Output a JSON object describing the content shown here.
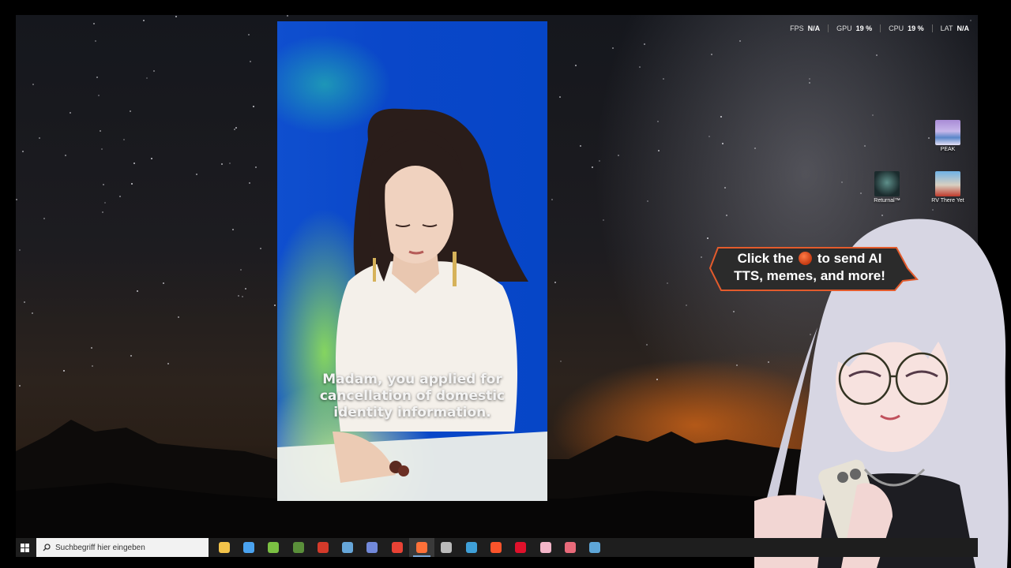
{
  "perf_overlay": [
    {
      "label": "FPS",
      "value": "N/A"
    },
    {
      "label": "GPU",
      "value": "19 %"
    },
    {
      "label": "CPU",
      "value": "19 %"
    },
    {
      "label": "LAT",
      "value": "N/A"
    }
  ],
  "desktop_icons": [
    {
      "label": "PEAK",
      "icon": "peak-game-icon"
    },
    {
      "label": "Returnal™",
      "icon": "returnal-game-icon"
    },
    {
      "label": "RV There Yet",
      "icon": "rv-there-yet-game-icon"
    }
  ],
  "video": {
    "subtitle_lines": [
      "Madam, you applied for",
      "cancellation of domestic",
      "identity information."
    ]
  },
  "callout": {
    "text_before": "Click the",
    "text_after": "to send AI",
    "line2": "TTS, memes, and more!",
    "icon": "bits-gem-icon"
  },
  "taskbar": {
    "search_placeholder": "Suchbegriff hier eingeben",
    "apps": [
      {
        "name": "file-explorer",
        "color": "#f3c34a"
      },
      {
        "name": "microsoft-store",
        "color": "#4aa3f0"
      },
      {
        "name": "android-app",
        "color": "#7bc043"
      },
      {
        "name": "minecraft",
        "color": "#5a8f3a"
      },
      {
        "name": "shop-app",
        "color": "#d43a2a"
      },
      {
        "name": "steam",
        "color": "#66a6d9"
      },
      {
        "name": "discord",
        "color": "#7289da"
      },
      {
        "name": "chrome",
        "color": "#e94235"
      },
      {
        "name": "firefox",
        "color": "#ff7139"
      },
      {
        "name": "obs-studio",
        "color": "#bbbbbb"
      },
      {
        "name": "sync-app",
        "color": "#3fa0d8"
      },
      {
        "name": "brave",
        "color": "#fb542b"
      },
      {
        "name": "opera",
        "color": "#e0112b"
      },
      {
        "name": "photo-app",
        "color": "#f3b5c8"
      },
      {
        "name": "pen-app",
        "color": "#e96a7a"
      },
      {
        "name": "steam-2",
        "color": "#5ea6d8"
      }
    ],
    "active_app_index": 8
  },
  "colors": {
    "video_blue": "#0a47c9",
    "bubble_fill": "#2b2b2b",
    "bubble_stroke": "#e35b2c",
    "taskbar": "#1e1e1e"
  }
}
